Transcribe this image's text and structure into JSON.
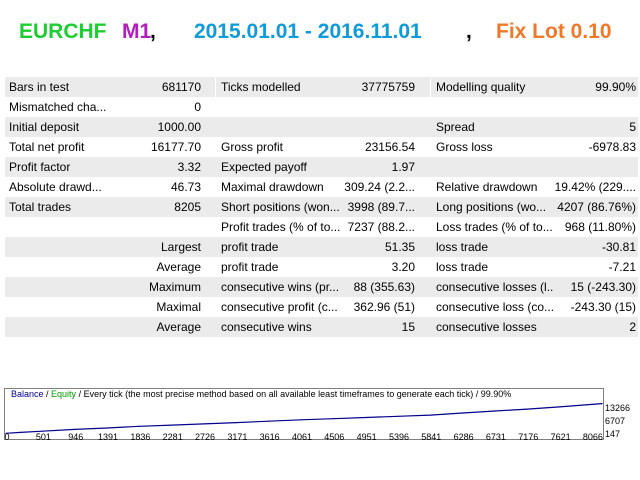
{
  "title": {
    "pair": "EURCHF",
    "timeframe": "M1",
    "comma1": ",",
    "dates": "2015.01.01 - 2016.11.01",
    "comma2": ",",
    "lot": "Fix Lot 0.10",
    "colors": {
      "pair": "#1fcc33",
      "timeframe": "#b01db8",
      "dates": "#119ad8",
      "lot": "#f0782a"
    }
  },
  "stats": {
    "bars_in_test_label": "Bars in test",
    "bars_in_test": "681170",
    "ticks_modelled_label": "Ticks modelled",
    "ticks_modelled": "37775759",
    "modelling_quality_label": "Modelling quality",
    "modelling_quality": "99.90%",
    "modelling_quality_fraction": 0.999,
    "mismatched_label": "Mismatched cha...",
    "mismatched": "0",
    "initial_deposit_label": "Initial deposit",
    "initial_deposit": "1000.00",
    "spread_label": "Spread",
    "spread": "5",
    "total_net_profit_label": "Total net profit",
    "total_net_profit": "16177.70",
    "gross_profit_label": "Gross profit",
    "gross_profit": "23156.54",
    "gross_loss_label": "Gross loss",
    "gross_loss": "-6978.83",
    "profit_factor_label": "Profit factor",
    "profit_factor": "3.32",
    "expected_payoff_label": "Expected payoff",
    "expected_payoff": "1.97",
    "absolute_drawdown_label": "Absolute drawd...",
    "absolute_drawdown": "46.73",
    "maximal_drawdown_label": "Maximal drawdown",
    "maximal_drawdown": "309.24 (2.2...",
    "relative_drawdown_label": "Relative drawdown",
    "relative_drawdown": "19.42% (229....",
    "total_trades_label": "Total trades",
    "total_trades": "8205",
    "short_positions_label": "Short positions (won...",
    "short_positions": "3998 (89.7...",
    "long_positions_label": "Long positions (wo...",
    "long_positions": "4207 (86.76%)",
    "profit_trades_label": "Profit trades (% of to...",
    "profit_trades": "7237 (88.2...",
    "loss_trades_label": "Loss trades (% of to...",
    "loss_trades": "968 (11.80%)",
    "largest_label": "Largest",
    "largest_profit_label": "profit trade",
    "largest_profit": "51.35",
    "largest_loss_label": "loss trade",
    "largest_loss": "-30.81",
    "average_label": "Average",
    "average_profit_label": "profit trade",
    "average_profit": "3.20",
    "average_loss_label": "loss trade",
    "average_loss": "-7.21",
    "maximum_label": "Maximum",
    "max_consec_wins_label": "consecutive wins (pr...",
    "max_consec_wins": "88 (355.63)",
    "max_consec_losses_label": "consecutive losses (l...",
    "max_consec_losses": "15 (-243.30)",
    "maximal_label": "Maximal",
    "maximal_consec_profit_label": "consecutive profit (c...",
    "maximal_consec_profit": "362.96 (51)",
    "maximal_consec_loss_label": "consecutive loss (co...",
    "maximal_consec_loss": "-243.30 (15)",
    "average2_label": "Average",
    "avg_consec_wins_label": "consecutive wins",
    "avg_consec_wins": "15",
    "avg_consec_losses_label": "consecutive losses",
    "avg_consec_losses": "2"
  },
  "chart": {
    "legend_balance": "Balance",
    "legend_sep1": " / ",
    "legend_equity": "Equity",
    "legend_rest": " / Every tick (the most precise method based on all available least timeframes to generate each tick) / 99.90%",
    "y_ticks": [
      "13266",
      "6707",
      "147"
    ],
    "x_ticks": [
      "0",
      "501",
      "946",
      "1391",
      "1836",
      "2281",
      "2726",
      "3171",
      "3616",
      "4061",
      "4506",
      "4951",
      "5396",
      "5841",
      "6286",
      "6731",
      "7176",
      "7621",
      "8066"
    ]
  },
  "chart_data": {
    "type": "line",
    "title": "",
    "xlabel": "",
    "ylabel": "",
    "ylim": [
      147,
      16500
    ],
    "xlim": [
      0,
      8205
    ],
    "series": [
      {
        "name": "Balance",
        "color": "#00008b",
        "x": [
          0,
          200,
          501,
          946,
          1391,
          1836,
          2281,
          2726,
          3171,
          3616,
          4061,
          4506,
          4951,
          5396,
          5841,
          6286,
          6731,
          7176,
          7621,
          8066,
          8205
        ],
        "y": [
          1000,
          1500,
          2100,
          3000,
          3700,
          4600,
          5200,
          5800,
          6500,
          7200,
          7900,
          8500,
          9100,
          9700,
          10300,
          11400,
          12400,
          13400,
          14500,
          15800,
          16178
        ]
      }
    ]
  }
}
